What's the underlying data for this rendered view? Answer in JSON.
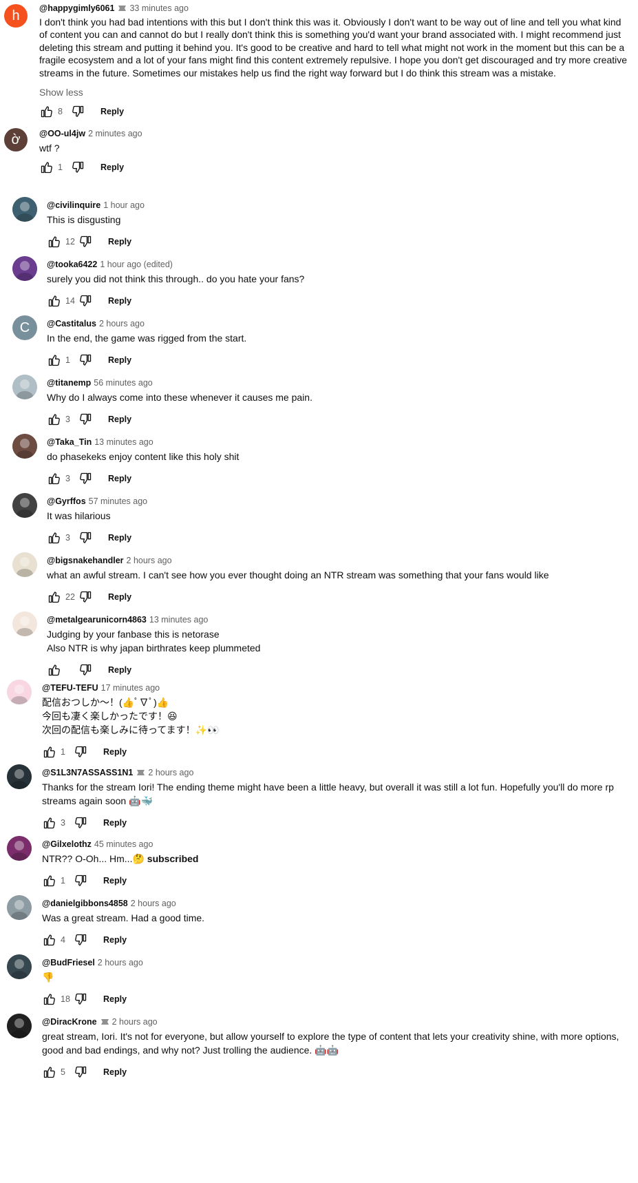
{
  "labels": {
    "reply": "Reply",
    "show_less": "Show less"
  },
  "colors": {
    "accent": "#0f0f0f",
    "muted": "#606060",
    "badge": "#909090"
  },
  "comments": [
    {
      "author": "@happygimly6061",
      "badge": "member-badge-icon",
      "time": "33 minutes ago",
      "text": "I don't think you had bad intentions with this but I don't think this was it. Obviously I don't want to be way out of line and tell you what kind of content you can and cannot do but I really don't think this is something you'd want your brand associated with. I might recommend just deleting this stream and putting it behind you. It's good to be creative and hard to tell what might not work in the moment but this can be a fragile ecosystem and a lot of your fans might find this content extremely repulsive. I hope you don't get discouraged and try more creative streams in the future. Sometimes our mistakes help us find the right way forward but I do think this stream was a mistake.",
      "likes": "8",
      "avatar_letter": "h",
      "avatar_color": "#f4511e"
    },
    {
      "author": "@OO-ul4jw",
      "time": "2 minutes ago",
      "text": "wtf ?",
      "likes": "1",
      "avatar_letter": "ờ",
      "avatar_color": "#5d4037"
    },
    {
      "author": "@civilinquire",
      "time": "1 hour ago",
      "text": "This is disgusting",
      "likes": "12",
      "avatar_color": "#3f6070"
    },
    {
      "author": "@tooka6422",
      "time": "1 hour ago (edited)",
      "text": "surely you did not think this through.. do you hate your fans?",
      "likes": "14",
      "avatar_color": "#6a3d8f"
    },
    {
      "author": "@Castitalus",
      "time": "2 hours ago",
      "text": "In the end, the game was rigged from the start.",
      "likes": "1",
      "avatar_letter": "C",
      "avatar_color": "#78909c"
    },
    {
      "author": "@titanemp",
      "time": "56 minutes ago",
      "text": "Why do I always come into these whenever it causes me pain.",
      "likes": "3",
      "avatar_color": "#b0bec5"
    },
    {
      "author": "@Taka_Tin",
      "time": "13 minutes ago",
      "text": "do phasekeks enjoy content like this holy shit",
      "likes": "3",
      "avatar_color": "#6d4c41"
    },
    {
      "author": "@Gyrffos",
      "time": "57 minutes ago",
      "text": "It was hilarious",
      "likes": "3",
      "avatar_color": "#424242"
    },
    {
      "author": "@bigsnakehandler",
      "time": "2 hours ago",
      "text": "what an awful stream. I can't see how you ever thought doing an NTR stream was something that your fans would like",
      "likes": "22",
      "avatar_color": "#e8e0d0"
    },
    {
      "author": "@metalgearunicorn4863",
      "time": "13 minutes ago",
      "text": "Judging by your fanbase this is netorase\nAlso NTR is why japan birthrates keep plummeted",
      "likes": "",
      "avatar_color": "#f3e6dc"
    },
    {
      "author": "@TEFU-TEFU",
      "time": "17 minutes ago",
      "text": "配信おつしか～！(👍ﾟ∇ﾟ)👍\n今回も凄く楽しかったです！😆\n次回の配信も楽しみに待ってます！✨👀",
      "likes": "1",
      "avatar_color": "#f8d7e3"
    },
    {
      "author": "@S1L3N7ASSASS1N1",
      "badge": "member-badge-icon",
      "time": "2 hours ago",
      "text": "Thanks for the stream Iori! The ending theme might have been a little heavy, but overall it was still a lot fun. Hopefully you'll do more rp streams again soon 🤖🐳",
      "likes": "3",
      "avatar_color": "#263238"
    },
    {
      "author": "@Gilxelothz",
      "time": "45 minutes ago",
      "text": "NTR?? O-Oh... Hm...🤔",
      "text_bold": " subscribed",
      "likes": "1",
      "avatar_color": "#7b2d6b"
    },
    {
      "author": "@danielgibbons4858",
      "time": "2 hours ago",
      "text": "Was a great stream. Had a good time.",
      "likes": "4",
      "avatar_color": "#8d9ca3"
    },
    {
      "author": "@BudFriesel",
      "time": "2 hours ago",
      "text": "👎",
      "likes": "18",
      "avatar_color": "#37474f"
    },
    {
      "author": "@DiracKrone",
      "badge": "member-badge-icon",
      "time": "2 hours ago",
      "text": "great stream, Iori. It's not for everyone, but allow yourself to explore the type of content that lets your creativity shine, with more options, good and bad endings, and why not? Just trolling the audience. 🤖🤖",
      "likes": "5",
      "avatar_color": "#212121"
    }
  ]
}
